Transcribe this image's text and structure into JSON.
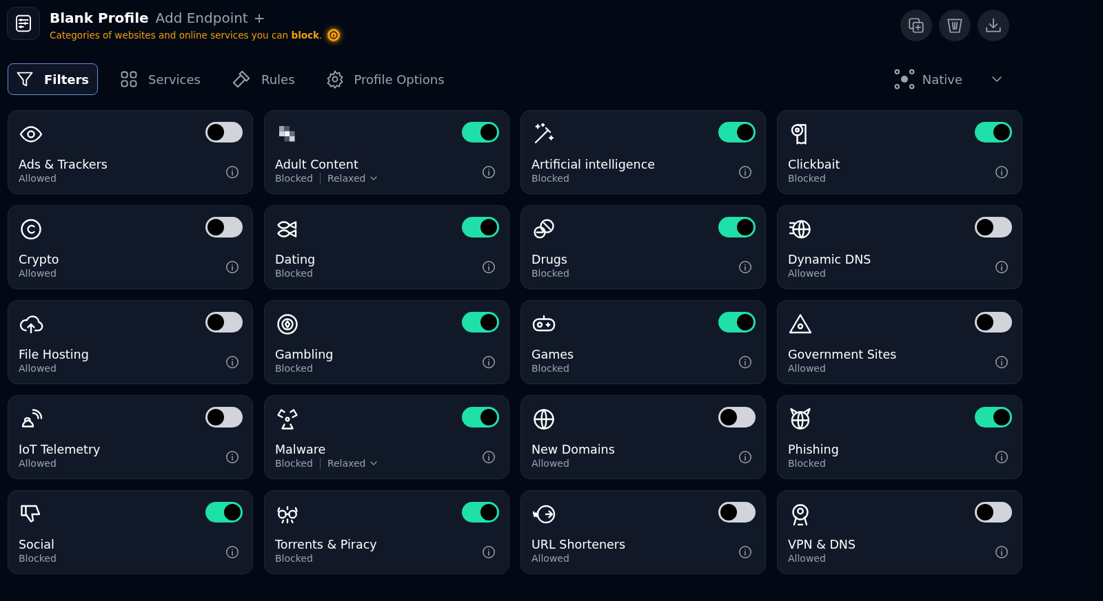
{
  "header": {
    "title": "Blank Profile",
    "add_endpoint": "Add Endpoint",
    "add_symbol": "+",
    "description": "Categories of websites and online services you can **block**."
  },
  "tabs": [
    {
      "label": "Filters",
      "selected": true
    },
    {
      "label": "Services",
      "selected": false
    },
    {
      "label": "Rules",
      "selected": false
    },
    {
      "label": "Profile Options",
      "selected": false
    }
  ],
  "mode_dropdown": {
    "value": "Native"
  },
  "filters": [
    {
      "name": "Ads & Trackers",
      "status": "Allowed",
      "on": false
    },
    {
      "name": "Adult Content",
      "status": "Blocked",
      "on": true,
      "level_option": "Relaxed"
    },
    {
      "name": "Artificial intelligence",
      "status": "Blocked",
      "on": true
    },
    {
      "name": "Clickbait",
      "status": "Blocked",
      "on": true
    },
    {
      "name": "Crypto",
      "status": "Allowed",
      "on": false
    },
    {
      "name": "Dating",
      "status": "Blocked",
      "on": true
    },
    {
      "name": "Drugs",
      "status": "Blocked",
      "on": true
    },
    {
      "name": "Dynamic DNS",
      "status": "Allowed",
      "on": false
    },
    {
      "name": "File Hosting",
      "status": "Allowed",
      "on": false
    },
    {
      "name": "Gambling",
      "status": "Blocked",
      "on": true
    },
    {
      "name": "Games",
      "status": "Blocked",
      "on": true
    },
    {
      "name": "Government Sites",
      "status": "Allowed",
      "on": false
    },
    {
      "name": "IoT Telemetry",
      "status": "Allowed",
      "on": false
    },
    {
      "name": "Malware",
      "status": "Blocked",
      "on": true,
      "level_option": "Relaxed"
    },
    {
      "name": "New Domains",
      "status": "Allowed",
      "on": false
    },
    {
      "name": "Phishing",
      "status": "Blocked",
      "on": true
    },
    {
      "name": "Social",
      "status": "Blocked",
      "on": true
    },
    {
      "name": "Torrents & Piracy",
      "status": "Blocked",
      "on": true
    },
    {
      "name": "URL Shorteners",
      "status": "Allowed",
      "on": false
    },
    {
      "name": "VPN & DNS",
      "status": "Allowed",
      "on": false
    }
  ]
}
